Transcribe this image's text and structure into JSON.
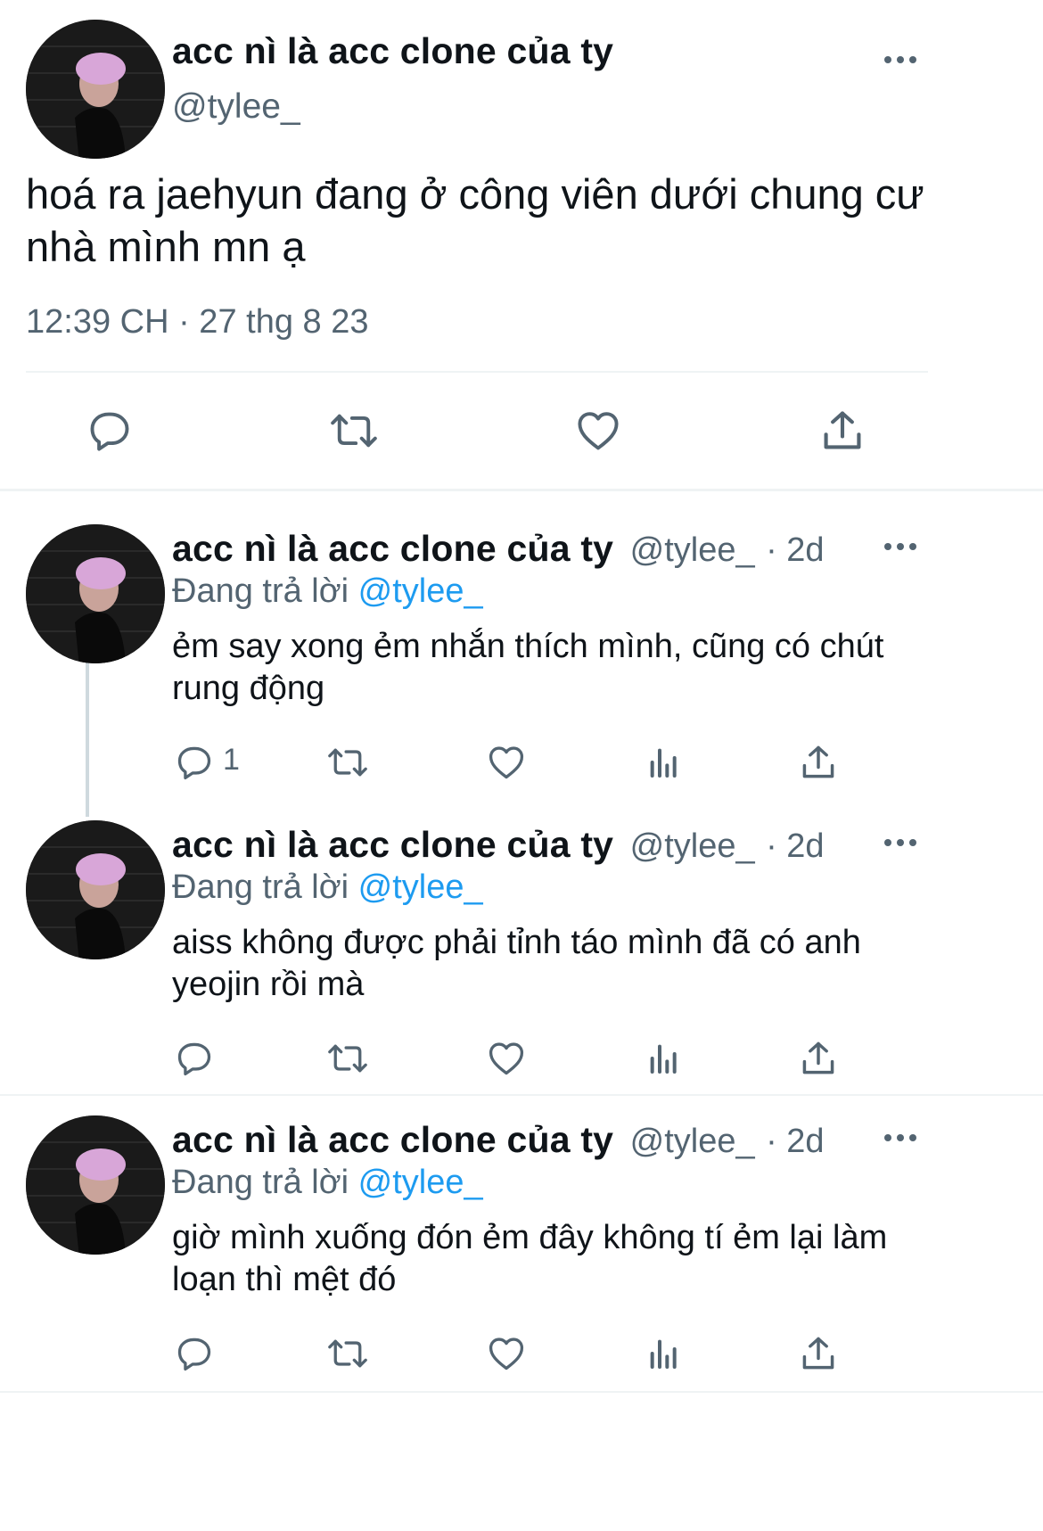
{
  "main_tweet": {
    "display_name": "acc nì là acc clone của ty",
    "handle": "@tylee_",
    "text": "hoá ra jaehyun đang ở công viên dưới chung cư nhà mình mn ạ",
    "timestamp": "12:39 CH · 27 thg 8 23"
  },
  "replies": [
    {
      "display_name": "acc nì là acc clone của ty",
      "handle": "@tylee_",
      "time": "· 2d",
      "replying_prefix": "Đang trả lời",
      "replying_to": "@tylee_",
      "text": "ẻm say xong ẻm nhắn thích mình, cũng có chút rung động",
      "reply_count": "1"
    },
    {
      "display_name": "acc nì là acc clone của ty",
      "handle": "@tylee_",
      "time": "· 2d",
      "replying_prefix": "Đang trả lời",
      "replying_to": "@tylee_",
      "text": "aiss không được phải tỉnh táo mình đã có anh yeojin rồi mà",
      "reply_count": ""
    },
    {
      "display_name": "acc nì là acc clone của ty",
      "handle": "@tylee_",
      "time": "· 2d",
      "replying_prefix": "Đang trả lời",
      "replying_to": "@tylee_",
      "text": "giờ mình xuống đón ẻm đây không tí ẻm lại làm loạn thì mệt đó",
      "reply_count": ""
    }
  ],
  "colors": {
    "text": "#0f1419",
    "muted": "#536471",
    "link": "#1d9bf0",
    "divider": "#eff3f4"
  },
  "icons": [
    "reply-icon",
    "retweet-icon",
    "like-icon",
    "views-icon",
    "share-icon",
    "more-icon"
  ]
}
